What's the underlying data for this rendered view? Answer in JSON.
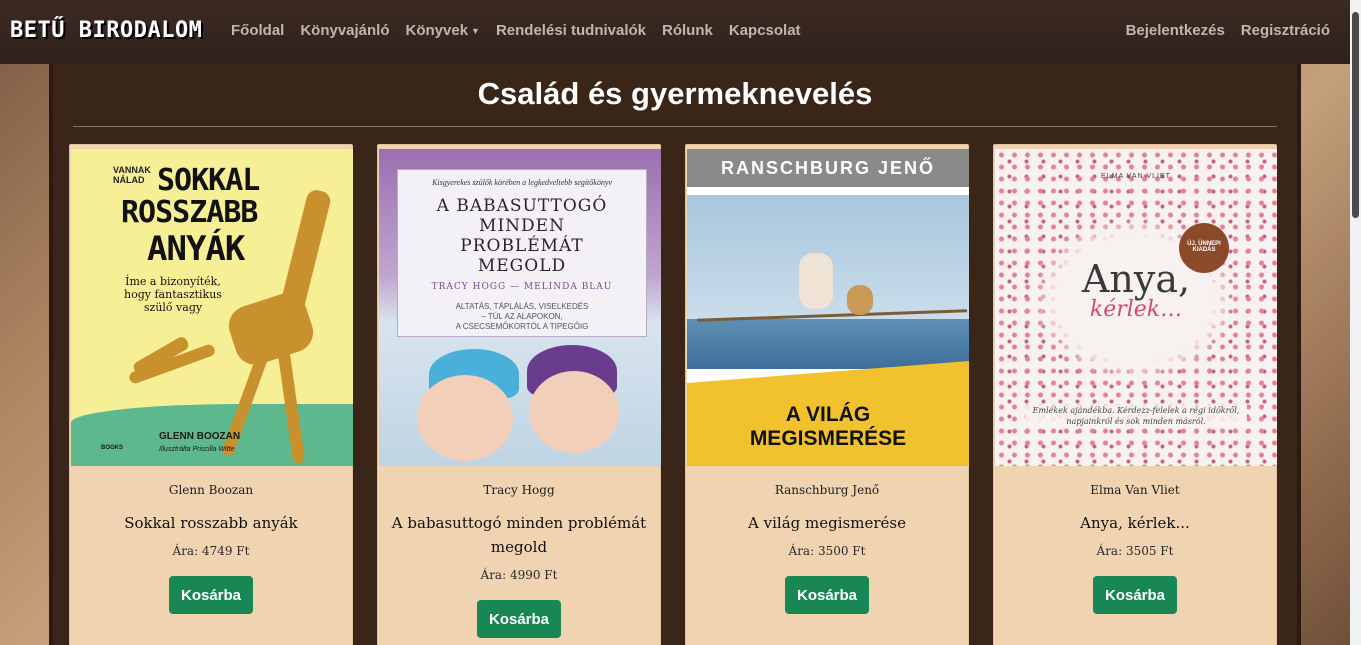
{
  "nav": {
    "brand": "BETŰ BIRODALOM",
    "links": [
      "Főoldal",
      "Könyvajánló",
      "Könyvek",
      "Rendelési tudnivalók",
      "Rólunk",
      "Kapcsolat"
    ],
    "right_links": [
      "Bejelentkezés",
      "Regisztráció"
    ]
  },
  "page": {
    "title": "Család és gyermeknevelés"
  },
  "books": [
    {
      "author": "Glenn Boozan",
      "title": "Sokkal rosszabb anyák",
      "price": "Ára: 4749 Ft",
      "button": "Kosárba",
      "cover": {
        "top": "VANNAK NÁLAD",
        "line1": "SOKKAL",
        "line2": "ROSSZABB",
        "line3": "ANYÁK",
        "sub": "Íme a bizonyíték, hogy fantasztikus szülő vagy",
        "author": "GLENN BOOZAN",
        "illustrator": "Illusztrálta Priscilla Witte",
        "publisher": "BOOKS"
      }
    },
    {
      "author": "Tracy Hogg",
      "title": "A babasuttogó minden problémát megold",
      "price": "Ára: 4990 Ft",
      "button": "Kosárba",
      "cover": {
        "top": "Kisgyerekes szülők körében a legkedveltebb segítőkönyv",
        "line1": "A BABASUTTOGÓ",
        "line2": "MINDEN",
        "line3": "PROBLÉMÁT",
        "line4": "MEGOLD",
        "authors": "TRACY HOGG — MELINDA BLAU",
        "desc1": "ALTATÁS, TÁPLÁLÁS, VISELKEDÉS",
        "desc2": "– TÚL AZ ALAPOKON,",
        "desc3": "A CSECSEMŐKORTÓL A TIPEGŐIG"
      }
    },
    {
      "author": "Ranschburg Jenő",
      "title": "A világ megismerése",
      "price": "Ára: 3500 Ft",
      "button": "Kosárba",
      "cover": {
        "author": "RANSCHBURG JENŐ",
        "line1": "A VILÁG",
        "line2": "MEGISMERÉSE"
      }
    },
    {
      "author": "Elma Van Vliet",
      "title": "Anya, kérlek...",
      "price": "Ára: 3505 Ft",
      "button": "Kosárba",
      "cover": {
        "author": "ELMA VAN VLIET",
        "badge": "ÚJ, ÜNNEPI KIADÁS",
        "line1": "Anya,",
        "line2": "kérlek…",
        "note": "Emlékek ajándékba. Kérdezz-felelek a régi időkről, napjainkról és sok minden másról."
      }
    }
  ]
}
